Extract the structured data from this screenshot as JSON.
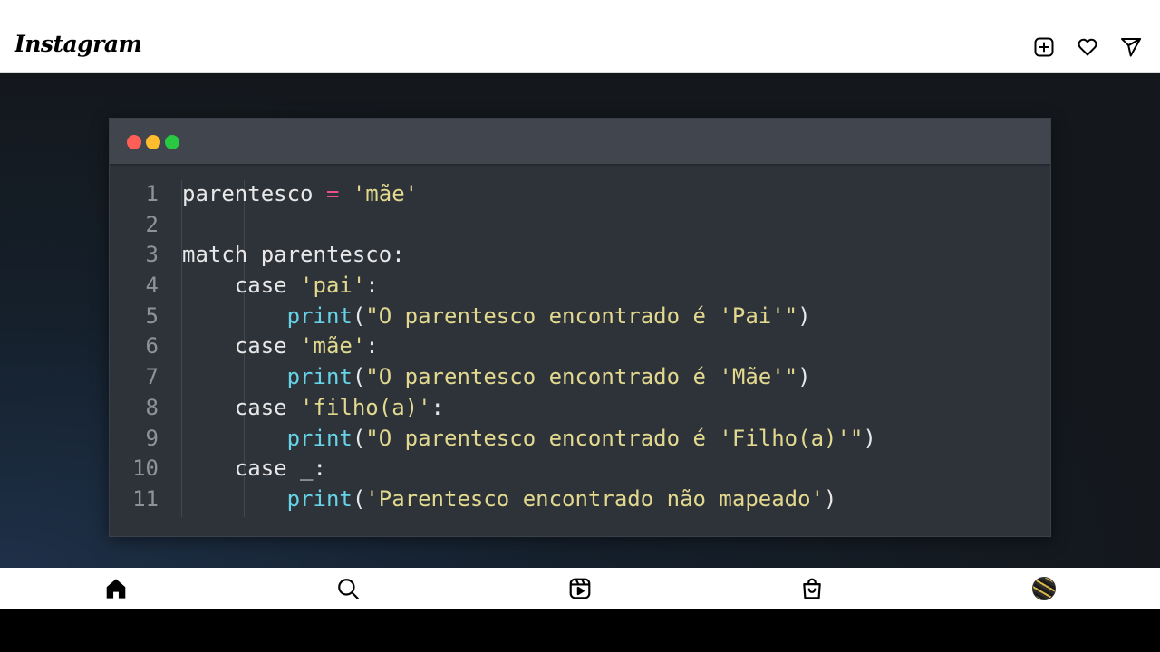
{
  "app": {
    "logo_text": "Instagram"
  },
  "header": {
    "icons": [
      "plus-square-icon",
      "heart-icon",
      "send-icon"
    ]
  },
  "post": {
    "editor": {
      "window_dots": {
        "red": "#ff5f57",
        "yellow": "#febc2e",
        "green": "#28c840"
      },
      "code_lines": [
        {
          "number": "1",
          "tokens": [
            {
              "t": "parentesco ",
              "c": "kw"
            },
            {
              "t": "=",
              "c": "op"
            },
            {
              "t": " ",
              "c": "kw"
            },
            {
              "t": "'mãe'",
              "c": "str"
            }
          ]
        },
        {
          "number": "2",
          "tokens": []
        },
        {
          "number": "3",
          "tokens": [
            {
              "t": "match parentesco:",
              "c": "kw"
            }
          ]
        },
        {
          "number": "4",
          "tokens": [
            {
              "t": "    case ",
              "c": "kw"
            },
            {
              "t": "'pai'",
              "c": "str"
            },
            {
              "t": ":",
              "c": "kw"
            }
          ]
        },
        {
          "number": "5",
          "tokens": [
            {
              "t": "        ",
              "c": "kw"
            },
            {
              "t": "print",
              "c": "fn"
            },
            {
              "t": "(",
              "c": "kw"
            },
            {
              "t": "\"O parentesco encontrado é 'Pai'\"",
              "c": "str"
            },
            {
              "t": ")",
              "c": "kw"
            }
          ]
        },
        {
          "number": "6",
          "tokens": [
            {
              "t": "    case ",
              "c": "kw"
            },
            {
              "t": "'mãe'",
              "c": "str"
            },
            {
              "t": ":",
              "c": "kw"
            }
          ]
        },
        {
          "number": "7",
          "tokens": [
            {
              "t": "        ",
              "c": "kw"
            },
            {
              "t": "print",
              "c": "fn"
            },
            {
              "t": "(",
              "c": "kw"
            },
            {
              "t": "\"O parentesco encontrado é 'Mãe'\"",
              "c": "str"
            },
            {
              "t": ")",
              "c": "kw"
            }
          ]
        },
        {
          "number": "8",
          "tokens": [
            {
              "t": "    case ",
              "c": "kw"
            },
            {
              "t": "'filho(a)'",
              "c": "str"
            },
            {
              "t": ":",
              "c": "kw"
            }
          ]
        },
        {
          "number": "9",
          "tokens": [
            {
              "t": "        ",
              "c": "kw"
            },
            {
              "t": "print",
              "c": "fn"
            },
            {
              "t": "(",
              "c": "kw"
            },
            {
              "t": "\"O parentesco encontrado é 'Filho(a)'\"",
              "c": "str"
            },
            {
              "t": ")",
              "c": "kw"
            }
          ]
        },
        {
          "number": "10",
          "tokens": [
            {
              "t": "    case _:",
              "c": "kw"
            }
          ]
        },
        {
          "number": "11",
          "tokens": [
            {
              "t": "        ",
              "c": "kw"
            },
            {
              "t": "print",
              "c": "fn"
            },
            {
              "t": "(",
              "c": "kw"
            },
            {
              "t": "'Parentesco encontrado não mapeado'",
              "c": "str"
            },
            {
              "t": ")",
              "c": "kw"
            }
          ]
        }
      ]
    }
  },
  "bottom_nav": {
    "items": [
      "home-icon",
      "search-icon",
      "reels-icon",
      "shop-icon",
      "profile-avatar"
    ]
  }
}
